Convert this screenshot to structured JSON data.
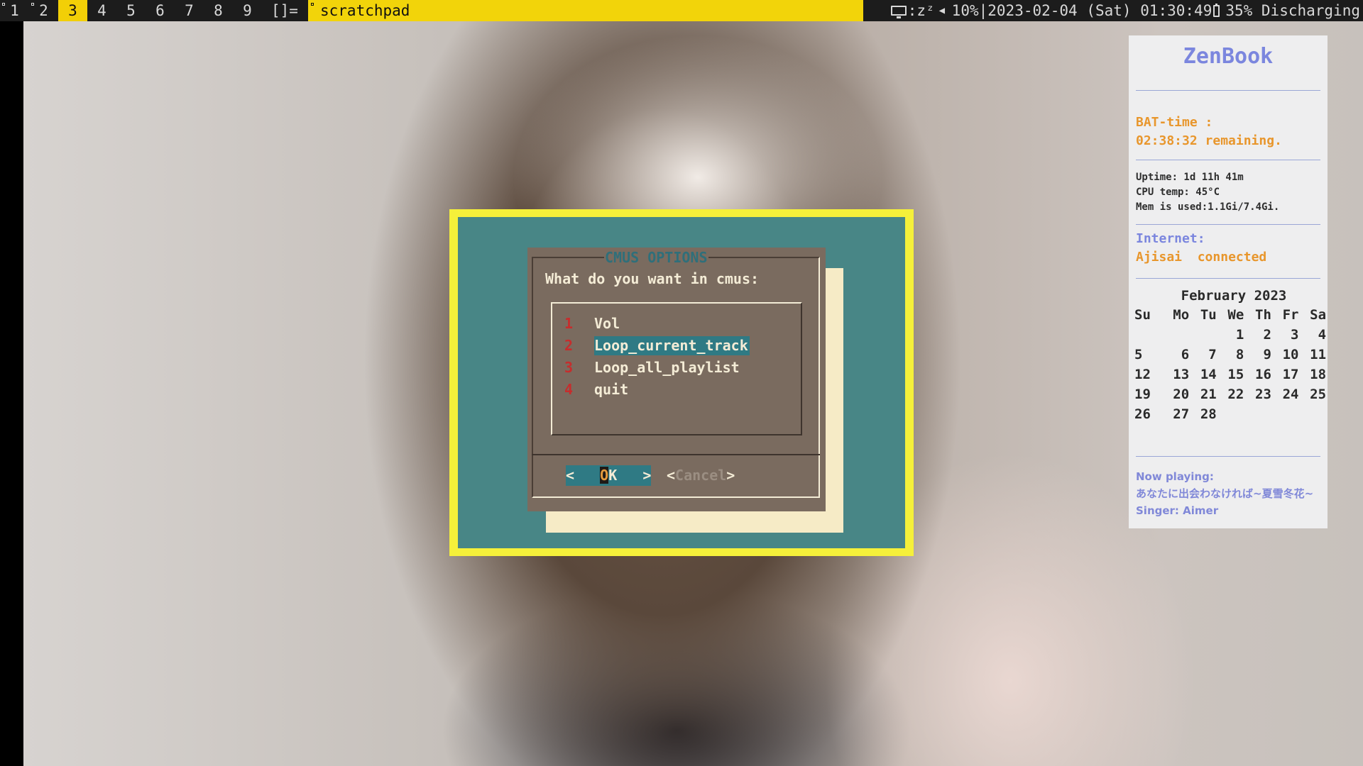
{
  "bar": {
    "tags": [
      "1",
      "2",
      "3",
      "4",
      "5",
      "6",
      "7",
      "8",
      "9"
    ],
    "selected_tag": "3",
    "occupied_tags": [
      "1",
      "2"
    ],
    "layout_symbol": "[]=",
    "window_title": "scratchpad",
    "status": {
      "display_text": ":zᶻ",
      "volume": "10%",
      "separator": "|",
      "datetime": "2023-02-04 (Sat) 01:30:49",
      "battery": "35% Discharging"
    },
    "colors": {
      "accent": "#f2d40a",
      "bar_bg": "#1c1c1c"
    }
  },
  "dialog": {
    "title": "CMUS OPTIONS",
    "prompt": "What do you want in cmus:",
    "items": [
      {
        "num": "1",
        "label": "Vol"
      },
      {
        "num": "2",
        "label": "Loop_current_track"
      },
      {
        "num": "3",
        "label": "Loop_all_playlist"
      },
      {
        "num": "4",
        "label": "quit"
      }
    ],
    "selected_item": "2",
    "ok_button": {
      "left": "<",
      "hot": "O",
      "rest": "K",
      "right": ">"
    },
    "cancel_button": {
      "left": "<",
      "text": "Cancel",
      "right": ">"
    },
    "colors": {
      "frame": "#f5f03a",
      "background": "#488686",
      "box": "#7a6b5f",
      "highlight": "#2f7a84"
    }
  },
  "conky": {
    "hostname": "ZenBook",
    "battery_label": "BAT-time :",
    "battery_remaining": "02:38:32 remaining.",
    "uptime": "Uptime: 1d 11h 41m",
    "cpu_temp": "CPU temp: 45°C",
    "memory": "Mem is used:1.1Gi/7.4Gi.",
    "internet_label": "Internet:",
    "network_name": "Ajisai",
    "network_status": "connected",
    "calendar": {
      "month": "February 2023",
      "weekdays": [
        "Su",
        "Mo",
        "Tu",
        "We",
        "Th",
        "Fr",
        "Sa"
      ],
      "weeks": [
        [
          "",
          "",
          "",
          "1",
          "2",
          "3",
          "4"
        ],
        [
          "5",
          "6",
          "7",
          "8",
          "9",
          "10",
          "11"
        ],
        [
          "12",
          "13",
          "14",
          "15",
          "16",
          "17",
          "18"
        ],
        [
          "19",
          "20",
          "21",
          "22",
          "23",
          "24",
          "25"
        ],
        [
          "26",
          "27",
          "28",
          "",
          "",
          "",
          ""
        ]
      ]
    },
    "now_playing_label": "Now playing:",
    "track": "あなたに出会わなければ~夏雪冬花~",
    "singer": "Singer: Aimer",
    "colors": {
      "title": "#7b86de",
      "warning": "#e8962c"
    }
  },
  "desktop": {
    "wallpaper": "photo of a woman with shoulder-length brown hair"
  }
}
